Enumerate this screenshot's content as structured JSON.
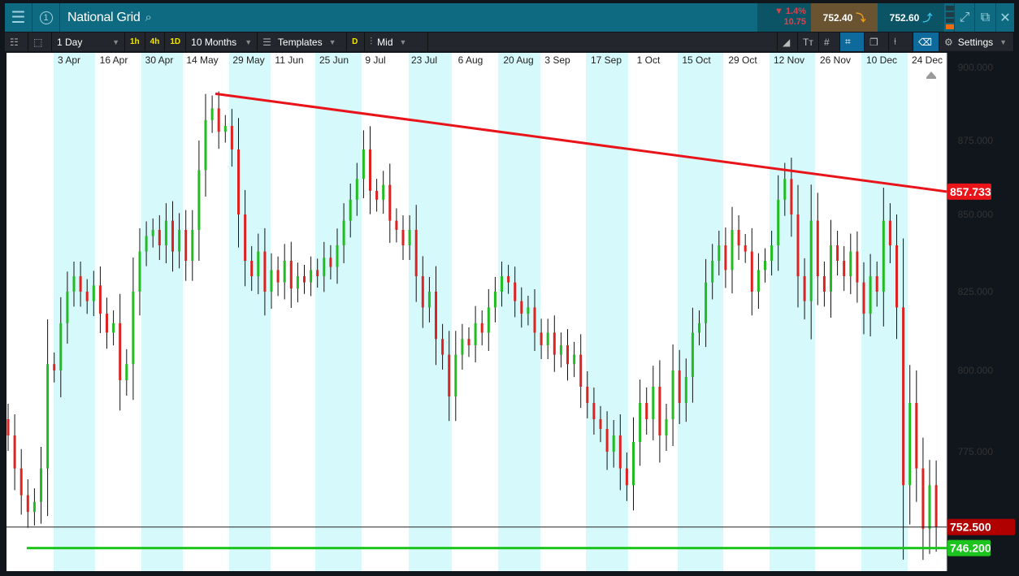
{
  "header": {
    "title": "National Grid",
    "badge": "1",
    "change_pct": "1.4%",
    "change_abs": "10.75",
    "sell": "752.40",
    "buy": "752.60"
  },
  "toolbar": {
    "interval": "1 Day",
    "quick": [
      "1h",
      "4h",
      "1D"
    ],
    "range": "10 Months",
    "templates": "Templates",
    "d": "D",
    "price_type": "Mid",
    "settings": "Settings"
  },
  "colors": {
    "up": "#22bb22",
    "down": "#dd2222",
    "trend": "#e8141a",
    "band": "#d6f9fb"
  },
  "chart_data": {
    "type": "candlestick",
    "instrument": "National Grid",
    "x_labels": [
      "3 Apr",
      "16 Apr",
      "30 Apr",
      "14 May",
      "29 May",
      "11 Jun",
      "25 Jun",
      "9 Jul",
      "23 Jul",
      "6 Aug",
      "20 Aug",
      "3 Sep",
      "17 Sep",
      "1 Oct",
      "15 Oct",
      "29 Oct",
      "12 Nov",
      "26 Nov",
      "10 Dec",
      "24 Dec"
    ],
    "y_ticks": [
      "900.000",
      "875.000",
      "850.000",
      "825.000",
      "800.000",
      "775.000"
    ],
    "ylim": [
      745,
      905
    ],
    "closes": [
      780,
      770,
      762,
      757,
      760,
      770,
      802,
      800,
      815,
      825,
      830,
      825,
      822,
      827,
      818,
      812,
      815,
      797,
      802,
      825,
      838,
      843,
      845,
      840,
      848,
      838,
      845,
      835,
      845,
      865,
      882,
      886,
      878,
      880,
      872,
      850,
      835,
      830,
      838,
      825,
      832,
      828,
      835,
      826,
      830,
      828,
      832,
      830,
      836,
      833,
      840,
      848,
      855,
      862,
      872,
      858,
      855,
      860,
      848,
      845,
      840,
      845,
      830,
      820,
      825,
      810,
      805,
      792,
      805,
      810,
      808,
      815,
      812,
      820,
      825,
      830,
      828,
      822,
      818,
      820,
      812,
      808,
      812,
      805,
      808,
      802,
      805,
      795,
      790,
      785,
      782,
      775,
      780,
      770,
      765,
      778,
      790,
      785,
      795,
      780,
      785,
      800,
      790,
      798,
      812,
      815,
      828,
      835,
      840,
      832,
      845,
      840,
      838,
      825,
      832,
      835,
      840,
      855,
      862,
      850,
      830,
      822,
      848,
      830,
      825,
      840,
      835,
      830,
      838,
      828,
      818,
      830,
      825,
      848,
      840,
      820,
      765,
      790,
      770,
      752,
      765,
      752.5
    ],
    "first_open": 785,
    "trendline": {
      "start": 891,
      "end": 857.733,
      "end_label": "857.733"
    },
    "support": {
      "value": 746.2,
      "label": "746.200"
    },
    "last_price": {
      "value": 752.5,
      "label": "752.500"
    }
  }
}
